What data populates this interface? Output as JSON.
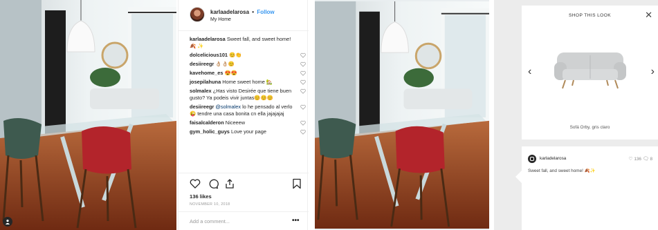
{
  "post": {
    "username": "karlaadelarosa",
    "separator": "•",
    "follow_label": "Follow",
    "location": "My Home",
    "caption_emoji": "🍂 ✨",
    "comments": [
      {
        "user": "karlaadelarosa",
        "text": "Sweet fall, and sweet home! 🍂 ✨",
        "has_heart": false
      },
      {
        "user": "dolcelicious101",
        "text": "😊👏",
        "has_heart": true
      },
      {
        "user": "desiireegr",
        "text": "👌🏼👌🏼😊",
        "has_heart": true
      },
      {
        "user": "kavehome_es",
        "text": "😍😍",
        "has_heart": true
      },
      {
        "user": "josepilahuna",
        "text": "Home sweet home 🏡",
        "has_heart": true
      },
      {
        "user": "solmalex",
        "text": "¿Has visto Desirée que tiene buen gusto? Ya podeis vivir juntas😊😊😊",
        "has_heart": true
      },
      {
        "user": "desiireegr",
        "mention": "@solmalex",
        "text": "lo he pensado al verlo😜 tendre una casa bonita cn ella jajajajaj",
        "has_heart": true
      },
      {
        "user": "faisalcalderon",
        "text": "Niceeew",
        "has_heart": true
      },
      {
        "user": "gym_holic_guys",
        "text": "Love your page",
        "has_heart": true
      }
    ],
    "likes": "136 likes",
    "date": "NOVEMBER 10, 2018",
    "add_comment_placeholder": "Add a comment...",
    "more_label": "•••"
  },
  "shop": {
    "title": "SHOP THIS LOOK",
    "close": "✕",
    "prev": "‹",
    "next": "›",
    "product_name": "Sofá Orby, gris claro",
    "username": "karladelarosa",
    "likes": "136",
    "comments": "8",
    "caption": "Sweet fall, and sweet home! 🍂✨"
  },
  "colors": {
    "follow": "#3897f0",
    "chair_green": "#3e5a4f",
    "chair_red": "#b3242b",
    "floor": "#8a3e1e",
    "sofa": "#c9cbcc"
  }
}
